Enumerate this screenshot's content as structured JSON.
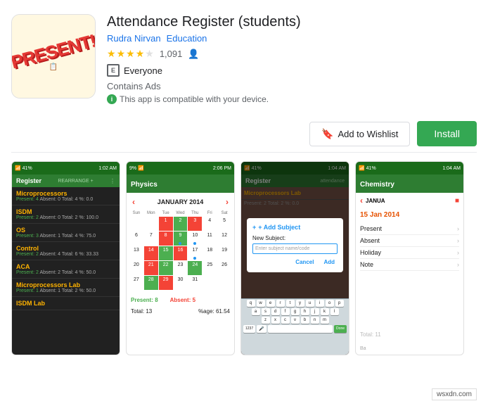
{
  "app": {
    "title": "Attendance Register (students)",
    "developer": "Rudra Nirvan",
    "category": "Education",
    "age_rating": "E",
    "age_label": "Everyone",
    "contains_ads": "Contains Ads",
    "compatible": "This app is compatible with your device.",
    "rating_count": "1,091",
    "wishlist_label": "Add to Wishlist",
    "install_label": "Install"
  },
  "icon": {
    "present_text": "PRESENT!"
  },
  "screenshots": [
    {
      "id": "ss1",
      "toolbar_title": "Register",
      "toolbar_btn": "REARRANGE",
      "subjects": [
        {
          "name": "Microprocessors",
          "stats": "Present: 4  Absent: 0  Total: 4  %: 0.0"
        },
        {
          "name": "ISDM",
          "stats": "Present: 2  Absent: 0  Total: 2  %: 100.0"
        },
        {
          "name": "OS",
          "stats": "Present: 3  Absent: 1  Total: 4  %: 75.0"
        },
        {
          "name": "Control",
          "stats": "Present: 2  Absent: 4  Total: 6  %: 33.33"
        },
        {
          "name": "ACA",
          "stats": "Present: 2  Absent: 2  Total: 4  %: 50.0"
        },
        {
          "name": "Microprocessors Lab",
          "stats": "Present: 1  Absent: 1  Total: 2  %: 50.0"
        },
        {
          "name": "ISDM Lab",
          "stats": ""
        }
      ]
    },
    {
      "id": "ss2",
      "toolbar_title": "Physics",
      "cal_title": "JANUARY 2014",
      "day_labels": [
        "Sun",
        "Mon",
        "Tue",
        "Wed",
        "Thu",
        "Fri",
        "Sat"
      ],
      "present_label": "Present: 8",
      "absent_label": "Absent: 5",
      "total_label": "Total: 13",
      "percent_label": "%age: 61.54"
    },
    {
      "id": "ss3",
      "toolbar_title": "Register",
      "toolbar_btn": "attendance",
      "add_subject_label": "+ Add Subject",
      "dialog_title": "+ Add Subject",
      "new_subject_label": "New Subject:",
      "input_placeholder": "Enter subject name/code",
      "cancel_btn": "Cancel",
      "add_btn": "Add",
      "keyboard_rows": [
        [
          "q",
          "w",
          "e",
          "r",
          "t",
          "y",
          "u",
          "i",
          "o",
          "p"
        ],
        [
          "a",
          "s",
          "d",
          "f",
          "g",
          "h",
          "j",
          "k",
          "l"
        ],
        [
          "z",
          "x",
          "c",
          "v",
          "b",
          "n",
          "m"
        ]
      ]
    },
    {
      "id": "ss4",
      "toolbar_title": "Chemistry",
      "cal_title": "JANUA",
      "date_label": "15 Jan 2014",
      "options": [
        "Present",
        "Absent",
        "Holiday",
        "Note"
      ],
      "total_label": "Total: 11"
    }
  ],
  "watermark": "wsxdn.com"
}
